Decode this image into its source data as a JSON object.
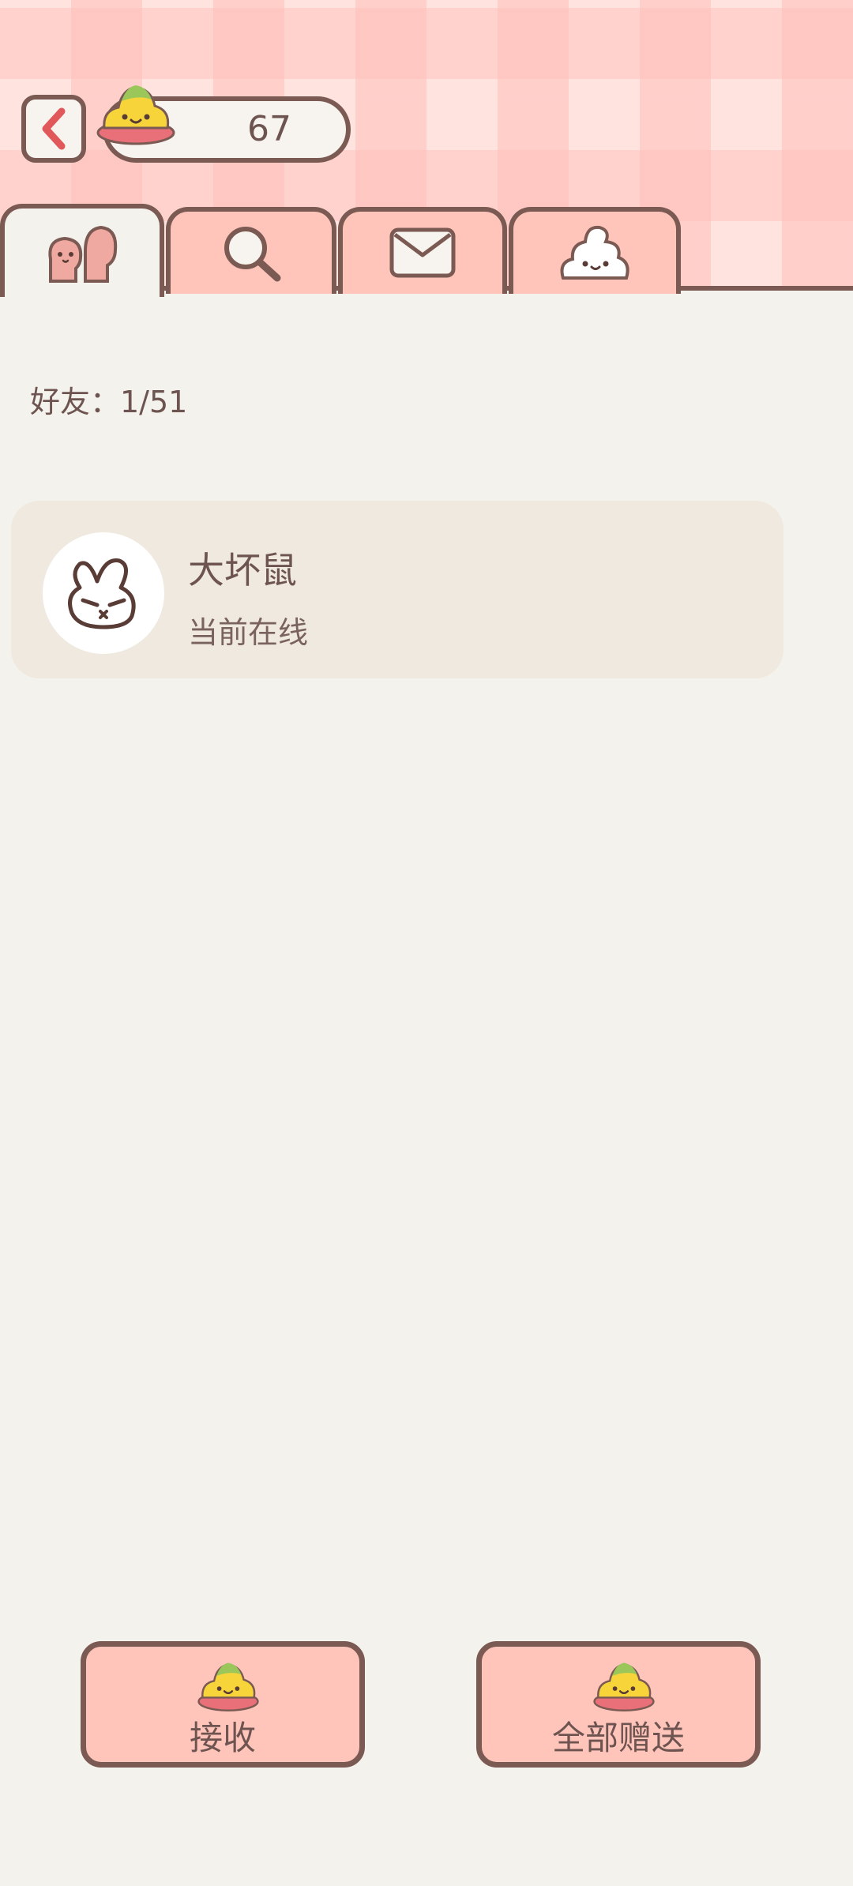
{
  "header": {
    "coin_count": "67",
    "coin_icon": "poop-coin-icon",
    "back_icon": "chevron-left-icon"
  },
  "tabs": [
    {
      "name": "friends",
      "icon": "friends-icon",
      "active": true
    },
    {
      "name": "search",
      "icon": "search-icon",
      "active": false
    },
    {
      "name": "mail",
      "icon": "mail-icon",
      "active": false
    },
    {
      "name": "poop",
      "icon": "poop-icon",
      "active": false
    }
  ],
  "friends": {
    "count_label": "好友：1/51",
    "list": [
      {
        "name": "大坏鼠",
        "status": "当前在线",
        "avatar": "bunny-avatar-icon"
      }
    ]
  },
  "actions": {
    "receive_label": "接收",
    "gift_all_label": "全部赠送"
  },
  "colors": {
    "accent": "#ffc4ba",
    "outline": "#7a5a52",
    "background": "#f4f2ec",
    "card": "#efe9df",
    "back_arrow": "#e0585a"
  }
}
